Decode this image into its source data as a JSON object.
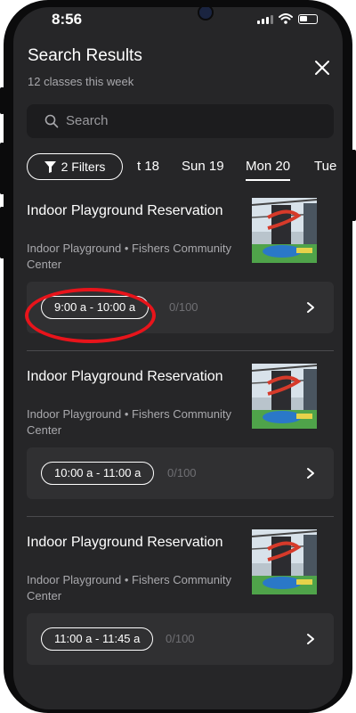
{
  "status_bar": {
    "time": "8:56"
  },
  "header": {
    "title": "Search Results",
    "subtitle": "12 classes this week"
  },
  "search": {
    "placeholder": "Search"
  },
  "filters": {
    "label": "2 Filters"
  },
  "day_tabs": [
    {
      "label": "t 18",
      "active": false
    },
    {
      "label": "Sun 19",
      "active": false
    },
    {
      "label": "Mon 20",
      "active": true
    },
    {
      "label": "Tue",
      "active": false
    }
  ],
  "results": [
    {
      "title": "Indoor Playground Reservation",
      "subtitle": "Indoor Playground • Fishers Community Center",
      "time_slot": "9:00 a - 10:00 a",
      "capacity": "0/100"
    },
    {
      "title": "Indoor Playground Reservation",
      "subtitle": "Indoor Playground • Fishers Community Center",
      "time_slot": "10:00 a - 11:00 a",
      "capacity": "0/100"
    },
    {
      "title": "Indoor Playground Reservation",
      "subtitle": "Indoor Playground • Fishers Community Center",
      "time_slot": "11:00 a - 11:45 a",
      "capacity": "0/100"
    }
  ],
  "colors": {
    "background": "#262628",
    "highlight_circle": "#e8141b"
  }
}
